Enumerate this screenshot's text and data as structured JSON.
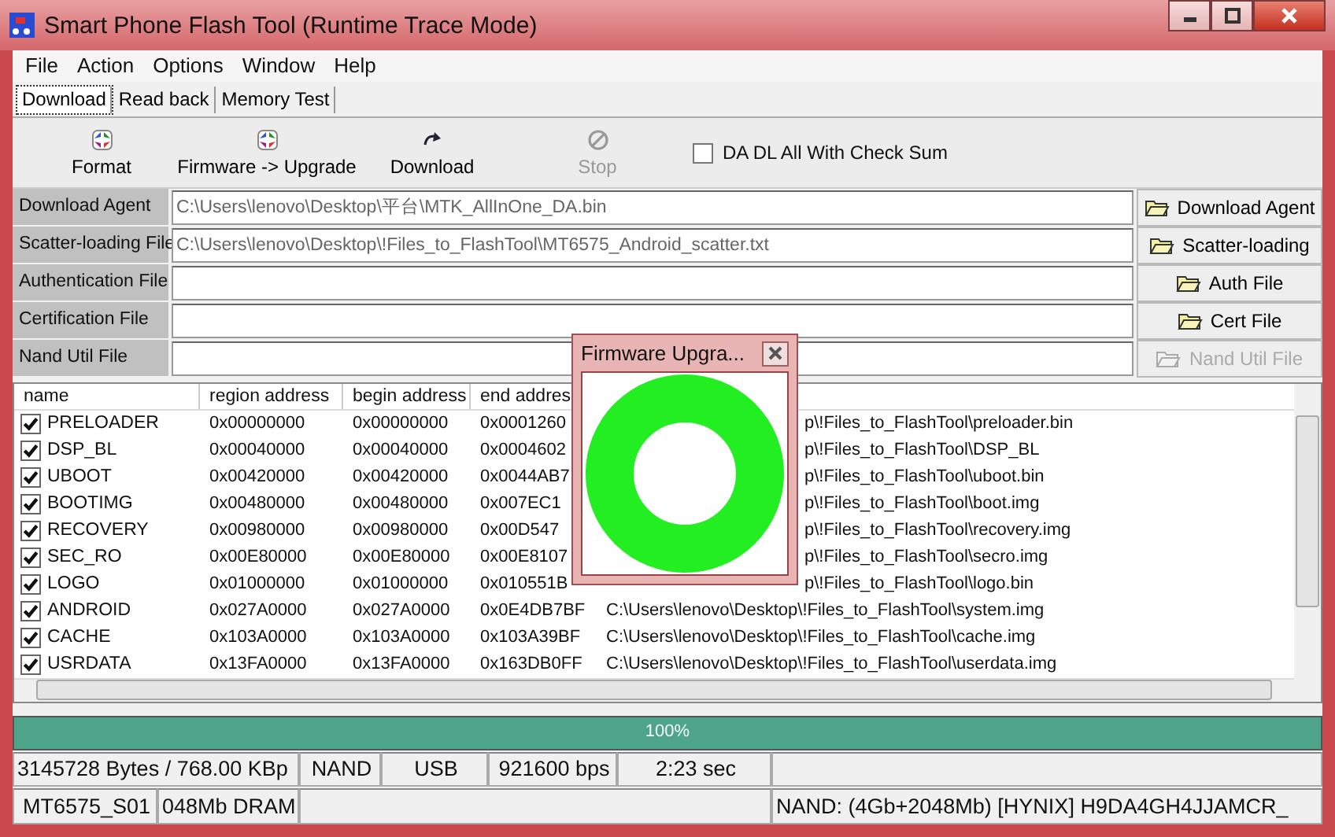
{
  "window": {
    "title": "Smart Phone Flash Tool (Runtime Trace Mode)"
  },
  "menu": [
    "File",
    "Action",
    "Options",
    "Window",
    "Help"
  ],
  "tabs": [
    {
      "label": "Download",
      "selected": true
    },
    {
      "label": "Read back",
      "selected": false
    },
    {
      "label": "Memory Test",
      "selected": false
    }
  ],
  "toolbar": [
    {
      "label": "Format",
      "kind": "format",
      "disabled": false
    },
    {
      "label": "Firmware -> Upgrade",
      "kind": "format",
      "disabled": false
    },
    {
      "label": "Download",
      "kind": "download",
      "disabled": false
    },
    {
      "label": "Stop",
      "kind": "stop",
      "disabled": true
    }
  ],
  "checksum": {
    "label": "DA DL All With Check Sum",
    "checked": false
  },
  "files": [
    {
      "label": "Download Agent",
      "value": "C:\\Users\\lenovo\\Desktop\\平台\\MTK_AllInOne_DA.bin",
      "button": "Download Agent",
      "disabled": false
    },
    {
      "label": "Scatter-loading File",
      "value": "C:\\Users\\lenovo\\Desktop\\!Files_to_FlashTool\\MT6575_Android_scatter.txt",
      "button": "Scatter-loading",
      "disabled": false
    },
    {
      "label": "Authentication File",
      "button": "Auth File",
      "disabled": false
    },
    {
      "label": "Certification File",
      "button": "Cert File",
      "disabled": false
    },
    {
      "label": "Nand Util File",
      "button": "Nand Util File",
      "disabled": true
    }
  ],
  "table": {
    "columns": [
      "name",
      "region address",
      "begin address",
      "end addres"
    ],
    "rows": [
      {
        "name": "PRELOADER",
        "checked": true,
        "region": "0x00000000",
        "begin": "0x00000000",
        "end": "0x0001260",
        "path": "p\\!Files_to_FlashTool\\preloader.bin",
        "covered": true
      },
      {
        "name": "DSP_BL",
        "checked": true,
        "region": "0x00040000",
        "begin": "0x00040000",
        "end": "0x0004602",
        "path": "p\\!Files_to_FlashTool\\DSP_BL",
        "covered": true
      },
      {
        "name": "UBOOT",
        "checked": true,
        "region": "0x00420000",
        "begin": "0x00420000",
        "end": "0x0044AB7",
        "path": "p\\!Files_to_FlashTool\\uboot.bin",
        "covered": true
      },
      {
        "name": "BOOTIMG",
        "checked": true,
        "region": "0x00480000",
        "begin": "0x00480000",
        "end": "0x007EC1",
        "path": "p\\!Files_to_FlashTool\\boot.img",
        "covered": true
      },
      {
        "name": "RECOVERY",
        "checked": true,
        "region": "0x00980000",
        "begin": "0x00980000",
        "end": "0x00D547",
        "path": "p\\!Files_to_FlashTool\\recovery.img",
        "covered": true
      },
      {
        "name": "SEC_RO",
        "checked": true,
        "region": "0x00E80000",
        "begin": "0x00E80000",
        "end": "0x00E8107",
        "path": "p\\!Files_to_FlashTool\\secro.img",
        "covered": true
      },
      {
        "name": "LOGO",
        "checked": true,
        "region": "0x01000000",
        "begin": "0x01000000",
        "end": "0x010551B",
        "path": "p\\!Files_to_FlashTool\\logo.bin",
        "covered": true
      },
      {
        "name": "ANDROID",
        "checked": true,
        "region": "0x027A0000",
        "begin": "0x027A0000",
        "end": "0x0E4DB7BF",
        "path": "C:\\Users\\lenovo\\Desktop\\!Files_to_FlashTool\\system.img",
        "covered": false
      },
      {
        "name": "CACHE",
        "checked": true,
        "region": "0x103A0000",
        "begin": "0x103A0000",
        "end": "0x103A39BF",
        "path": "C:\\Users\\lenovo\\Desktop\\!Files_to_FlashTool\\cache.img",
        "covered": false
      },
      {
        "name": "USRDATA",
        "checked": true,
        "region": "0x13FA0000",
        "begin": "0x13FA0000",
        "end": "0x163DB0FF",
        "path": "C:\\Users\\lenovo\\Desktop\\!Files_to_FlashTool\\userdata.img",
        "covered": false
      }
    ]
  },
  "progress": {
    "level": 1,
    "text": "100%"
  },
  "status": [
    [
      "3145728 Bytes / 768.00 KBp",
      "NAND",
      "USB",
      "921600 bps",
      "2:23 sec"
    ],
    [
      "MT6575_S01",
      "048Mb DRAM",
      "NAND: (4Gb+2048Mb) [HYNIX] H9DA4GH4JJAMCR_"
    ]
  ],
  "popup": {
    "title": "Firmware Upgra..."
  }
}
